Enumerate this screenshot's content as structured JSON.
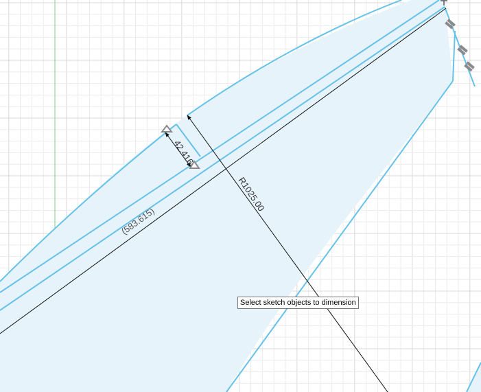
{
  "workspace": {
    "background": "#ffffff",
    "grid_minor_color": "#ececec",
    "grid_major_color": "#d9d9d9",
    "y_axis_color": "#7dd07d",
    "profile_fill": "#e6f3fb",
    "sketch_line_color": "#66c2e8",
    "dimension_line_color": "#111111"
  },
  "dimensions": {
    "thickness": "42.416",
    "radius": "R1025.00",
    "reference_length": "(583.615)"
  },
  "constraints": {
    "items": [
      "horizontal-constraint-icon",
      "parallel-constraint-icon",
      "parallel-constraint-icon",
      "parallel-constraint-icon"
    ]
  },
  "tooltip": {
    "text": "Select sketch objects to dimension"
  }
}
